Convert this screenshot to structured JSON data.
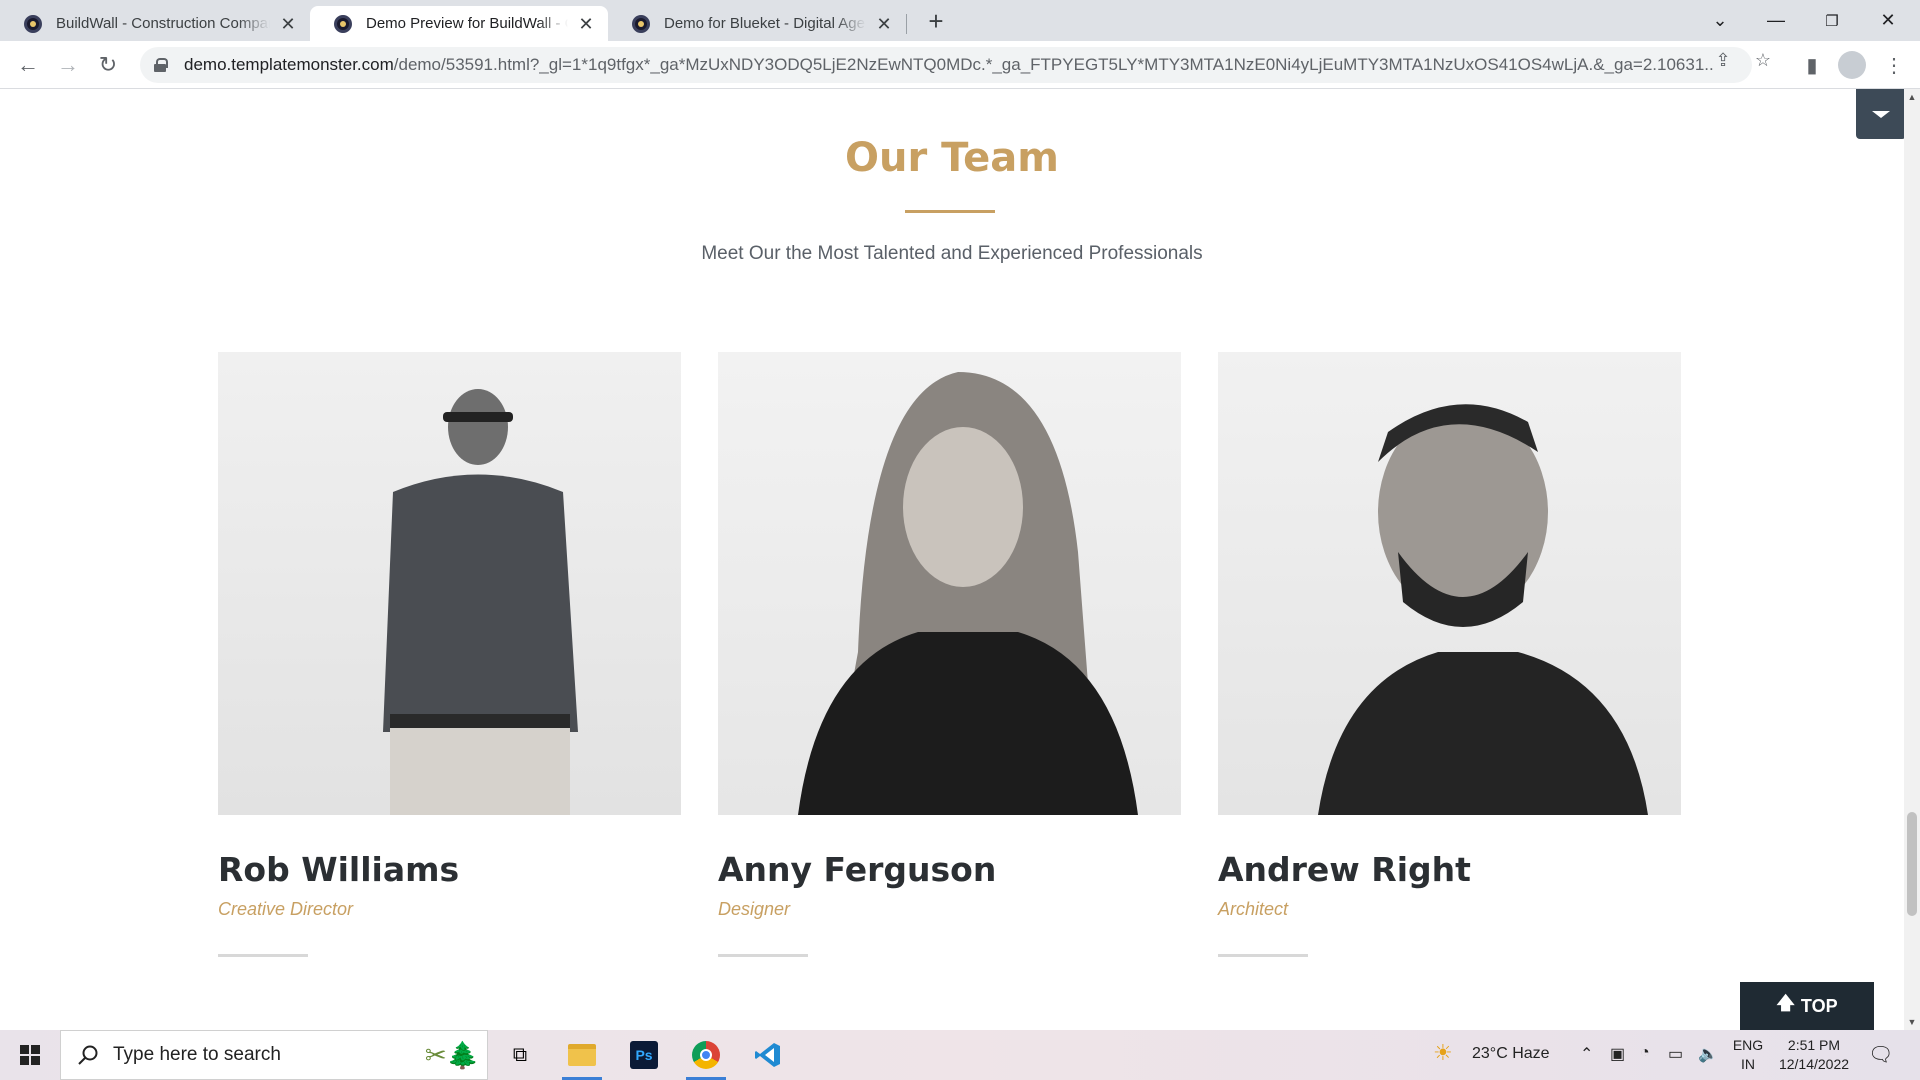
{
  "browser": {
    "tabs": [
      {
        "title": "BuildWall - Construction Company"
      },
      {
        "title": "Demo Preview for BuildWall - Construction"
      },
      {
        "title": "Demo for Blueket - Digital Agency"
      }
    ],
    "url_main": "demo.templatemonster.com",
    "url_rest": "/demo/53591.html?_gl=1*1q9tfgx*_ga*MzUxNDY3ODQ5LjE2NzEwNTQ0MDc.*_ga_FTPYEGT5LY*MTY3MTA1NzE0Ni4yLjEuMTY3MTA1NzUxOS41OS4wLjA.&_ga=2.10631..."
  },
  "page": {
    "heading": "Our Team",
    "subtitle": "Meet Our the Most Talented and Experienced Professionals",
    "team": [
      {
        "name": "Rob Williams",
        "role": "Creative Director"
      },
      {
        "name": "Anny Ferguson",
        "role": "Designer"
      },
      {
        "name": "Andrew Right",
        "role": "Architect"
      }
    ],
    "top_button": "TOP"
  },
  "taskbar": {
    "search_placeholder": "Type here to search",
    "weather": "23°C  Haze",
    "lang_1": "ENG",
    "lang_2": "IN",
    "time": "2:51 PM",
    "date": "12/14/2022"
  },
  "colors": {
    "accent_gold": "#c8a062",
    "dark_text": "#2b2f33",
    "top_button_bg": "#1f2a33"
  }
}
